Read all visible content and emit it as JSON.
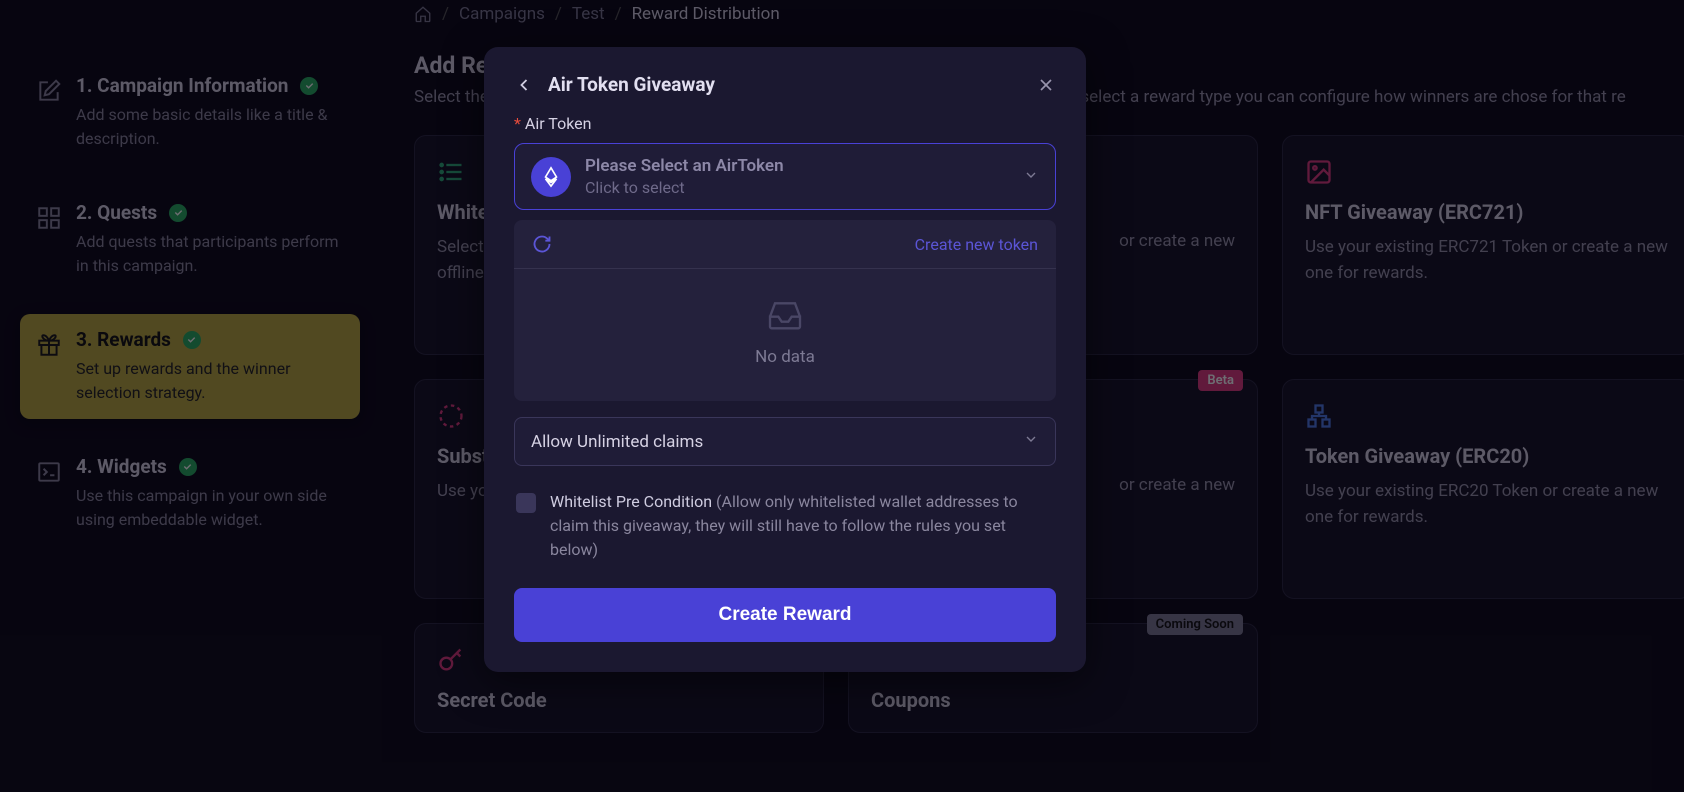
{
  "breadcrumb": {
    "items": [
      "Campaigns",
      "Test",
      "Reward Distribution"
    ]
  },
  "sidebar": {
    "steps": [
      {
        "title": "1. Campaign Information",
        "desc": "Add some basic details like a title & description."
      },
      {
        "title": "2. Quests",
        "desc": "Add quests that participants perform in this campaign."
      },
      {
        "title": "3. Rewards",
        "desc": "Set up rewards and the winner selection strategy."
      },
      {
        "title": "4. Widgets",
        "desc": "Use this campaign in your own side using embeddable widget."
      }
    ]
  },
  "page": {
    "title": "Add Rewards",
    "subtitle": "Select the types of rewards participants can win for completing the campaign. Once you select a reward type you can configure how winners are chose for that re"
  },
  "cards": {
    "whitelist": {
      "title": "Whitelist",
      "desc": "Select winners for Whitelist and export the list offline."
    },
    "nft721": {
      "title": "NFT Giveaway (ERC721)",
      "desc": "Use your existing ERC721 Token or create a new one for rewards."
    },
    "hidden1": {
      "title": "",
      "desc": "or create a new"
    },
    "substack": {
      "title": "Subst",
      "desc": "Use your new one"
    },
    "hidden2": {
      "title": "",
      "desc": "or create a new"
    },
    "erc20": {
      "title": "Token Giveaway (ERC20)",
      "desc": "Use your existing ERC20 Token or create a new one for rewards."
    },
    "secret": {
      "title": "Secret Code"
    },
    "coupons": {
      "title": "Coupons"
    }
  },
  "badges": {
    "beta": "Beta",
    "soon": "Coming Soon"
  },
  "modal": {
    "title": "Air Token Giveaway",
    "field_label": "Air Token",
    "select_line1": "Please Select an AirToken",
    "select_line2": "Click to select",
    "create_link": "Create new token",
    "no_data": "No data",
    "claims_select": "Allow Unlimited claims",
    "whitelist_label": "Whitelist Pre Condition",
    "whitelist_hint": "(Allow only whitelisted wallet addresses to claim this giveaway, they will still have to follow the rules you set below)",
    "submit": "Create Reward"
  }
}
